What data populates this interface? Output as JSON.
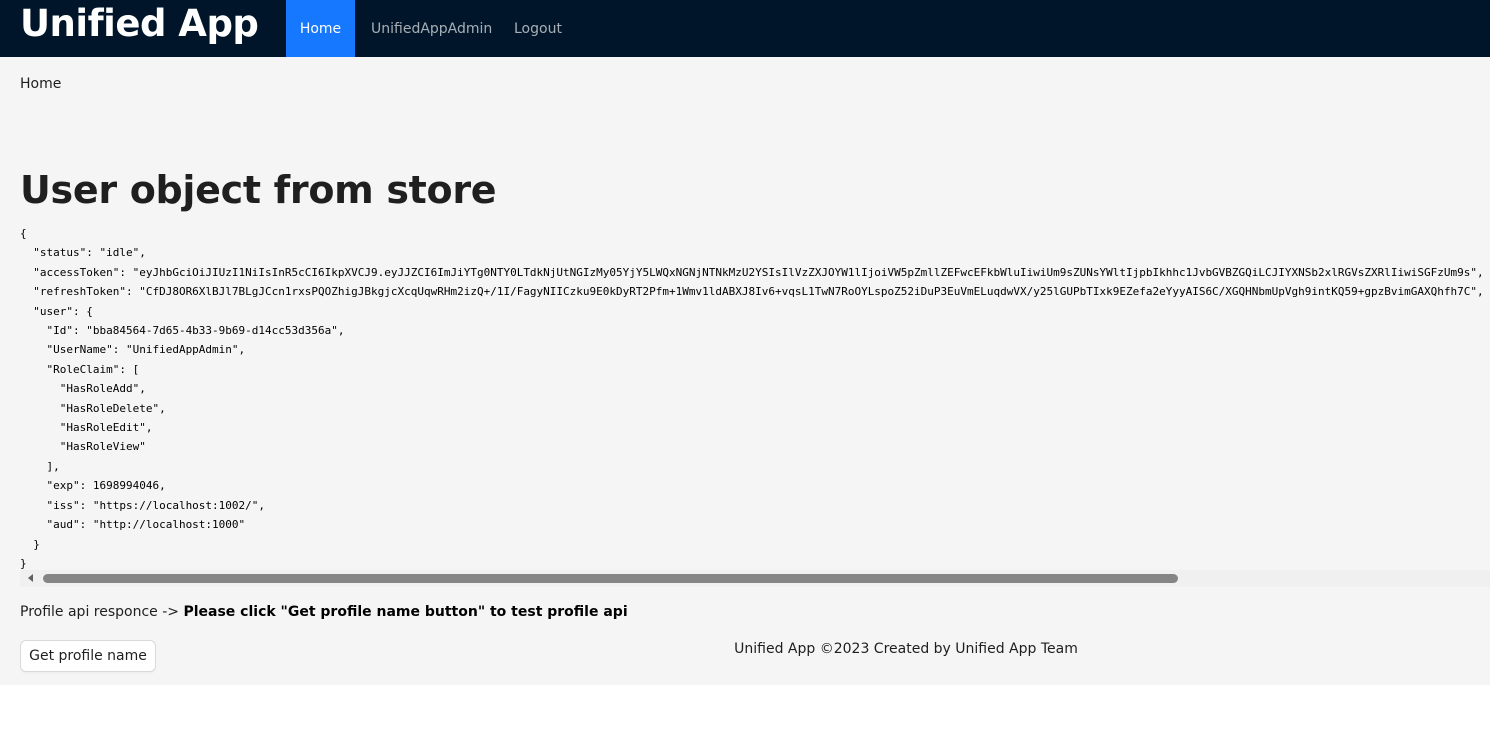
{
  "header": {
    "brand": "Unified App",
    "menu": [
      {
        "label": "Home",
        "active": true
      },
      {
        "label": "UnifiedAppAdmin",
        "active": false
      },
      {
        "label": "Logout",
        "active": false
      }
    ]
  },
  "breadcrumb": "Home",
  "page_title": "User object from store",
  "json_text": "{\n  \"status\": \"idle\",\n  \"accessToken\": \"eyJhbGciOiJIUzI1NiIsInR5cCI6IkpXVCJ9.eyJJZCI6ImJiYTg0NTY0LTdkNjUtNGIzMy05YjY5LWQxNGNjNTNkMzU2YSIsIlVzZXJOYW1lIjoiVW5pZmllZEFwcEFkbWluIiwiUm9sZUNsYWltIjpbIkhhc1JvbGVBZGQiLCJIYXNSb2xlRGVsZXRlIiwiSGFzUm9s\",\n  \"refreshToken\": \"CfDJ8OR6XlBJl7BLgJCcn1rxsPQOZhigJBkgjcXcqUqwRHm2izQ+/1I/FagyNIICzku9E0kDyRT2Pfm+1Wmv1ldABXJ8Iv6+vqsL1TwN7RoOYLspoZ52iDuP3EuVmELuqdwVX/y25lGUPbTIxk9EZefa2eYyyAIS6C/XGQHNbmUpVgh9intKQ59+gpzBvimGAXQhfh7C\",\n  \"user\": {\n    \"Id\": \"bba84564-7d65-4b33-9b69-d14cc53d356a\",\n    \"UserName\": \"UnifiedAppAdmin\",\n    \"RoleClaim\": [\n      \"HasRoleAdd\",\n      \"HasRoleDelete\",\n      \"HasRoleEdit\",\n      \"HasRoleView\"\n    ],\n    \"exp\": 1698994046,\n    \"iss\": \"https://localhost:1002/\",\n    \"aud\": \"http://localhost:1000\"\n  }\n}",
  "profile": {
    "prefix": "Profile api responce -> ",
    "message": "Please click \"Get profile name button\" to test profile api"
  },
  "button_label": "Get profile name",
  "footer": "Unified App ©2023 Created by Unified App Team",
  "colors": {
    "header_bg": "#001529",
    "active_menu": "#1677ff",
    "content_bg": "#f5f5f5"
  }
}
